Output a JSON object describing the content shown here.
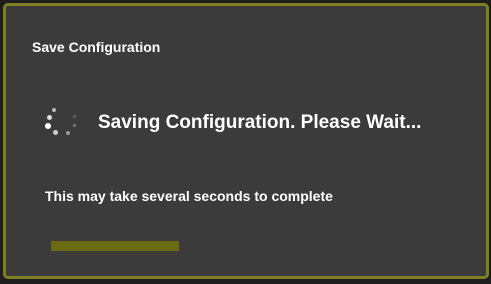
{
  "dialog": {
    "title": "Save Configuration",
    "message": "Saving Configuration. Please Wait...",
    "subtext": "This may take several seconds to complete",
    "spinner_icon": "loading-spinner-icon",
    "progress_fraction": 0.32
  },
  "colors": {
    "border": "#7e7e23",
    "background": "#3b3b3b",
    "progress": "#6b6b14",
    "text": "#ffffff"
  }
}
